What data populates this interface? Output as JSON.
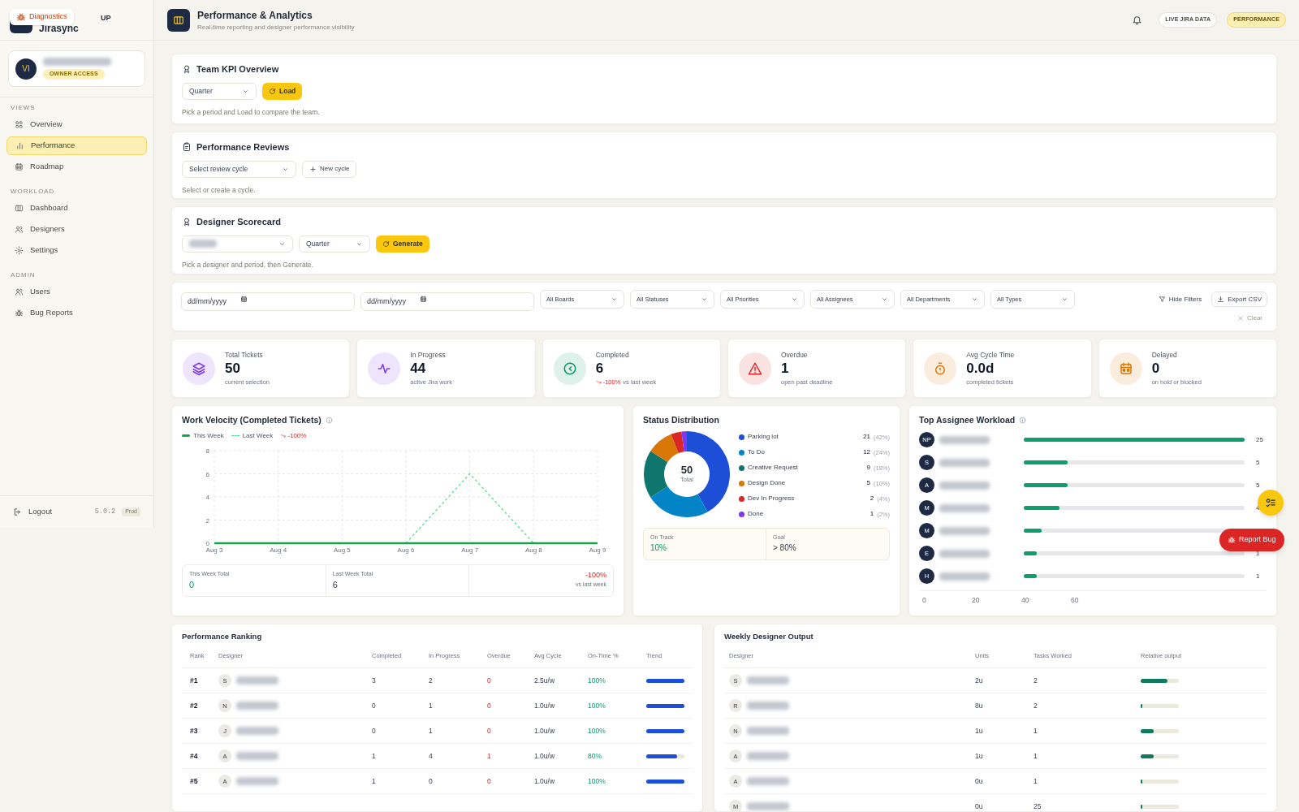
{
  "sidebar": {
    "brand": {
      "tag": "UP",
      "name": "Jirasync"
    },
    "diagnostics": "Diagnostics",
    "user": {
      "initials": "VI",
      "badge": "OWNER ACCESS"
    },
    "sections": [
      {
        "title": "VIEWS",
        "items": [
          {
            "label": "Overview",
            "selected": false
          },
          {
            "label": "Performance",
            "selected": true
          },
          {
            "label": "Roadmap",
            "selected": false
          }
        ]
      },
      {
        "title": "WORKLOAD",
        "items": [
          {
            "label": "Dashboard",
            "selected": false
          },
          {
            "label": "Designers",
            "selected": false
          },
          {
            "label": "Settings",
            "selected": false
          }
        ]
      },
      {
        "title": "ADMIN",
        "items": [
          {
            "label": "Users",
            "selected": false
          },
          {
            "label": "Bug Reports",
            "selected": false
          }
        ]
      }
    ],
    "logout": "Logout",
    "version": "5.0.2",
    "env": "Prod"
  },
  "header": {
    "title": "Performance & Analytics",
    "subtitle": "Real-time reporting and designer performance visibility",
    "badges": [
      {
        "label": "LIVE JIRA DATA",
        "kind": "outline"
      },
      {
        "label": "PERFORMANCE",
        "kind": "highlight"
      }
    ]
  },
  "panels": [
    {
      "title": "Team KPI Overview",
      "controls": [
        {
          "kind": "select",
          "value": "Quarter"
        },
        {
          "kind": "primary",
          "label": "Load"
        }
      ],
      "hint": "Pick a period and Load to compare the team."
    },
    {
      "title": "Performance Reviews",
      "controls": [
        {
          "kind": "select",
          "value": "Select review cycle"
        },
        {
          "kind": "secondary",
          "label": "New cycle"
        }
      ],
      "hint": "Select or create a cycle."
    },
    {
      "title": "Designer Scorecard",
      "controls": [
        {
          "kind": "blurred_select"
        },
        {
          "kind": "select",
          "value": "Quarter"
        },
        {
          "kind": "primary",
          "label": "Generate"
        }
      ],
      "hint": "Pick a designer and period, then Generate."
    }
  ],
  "filters": {
    "dates": [
      {
        "placeholder": "dd/mm/yyyy"
      },
      {
        "placeholder": "dd/mm/yyyy"
      }
    ],
    "selects": [
      "All Boards",
      "All Statuses",
      "All Priorities",
      "All Assignees",
      "All Departments",
      "All Types"
    ],
    "hide": "Hide Filters",
    "export": "Export CSV",
    "clear": "Clear"
  },
  "stats": [
    {
      "label": "Total Tickets",
      "value": "50",
      "note": "current selection",
      "color": "#7c3aed"
    },
    {
      "label": "In Progress",
      "value": "44",
      "note": "active Jira work",
      "color": "#7c3aed"
    },
    {
      "label": "Completed",
      "value": "6",
      "change": "-100%",
      "note": "vs last week",
      "color": "#059669"
    },
    {
      "label": "Overdue",
      "value": "1",
      "note": "open past deadline",
      "color": "#dc2626"
    },
    {
      "label": "Avg Cycle Time",
      "value": "0.0d",
      "note": "completed tickets",
      "color": "#d97706"
    },
    {
      "label": "Delayed",
      "value": "0",
      "note": "on hold or blocked",
      "color": "#d97706"
    }
  ],
  "velocity": {
    "title": "Work Velocity (Completed Tickets)",
    "legend_change": "-100%",
    "chart_data": {
      "type": "line",
      "grid": true,
      "categories": [
        "Aug 3",
        "Aug 4",
        "Aug 5",
        "Aug 6",
        "Aug 7",
        "Aug 8",
        "Aug 9"
      ],
      "ylim": [
        0,
        8
      ],
      "yticks": [
        {
          "value": 0,
          "label": "0"
        },
        {
          "value": 2,
          "label": "2"
        },
        {
          "value": 4,
          "label": "4"
        },
        {
          "value": 6,
          "label": "6"
        },
        {
          "value": 8,
          "label": "8"
        }
      ],
      "series": [
        {
          "name": "This Week",
          "color": "#16a34a",
          "line_style": "solid",
          "values": [
            0,
            0,
            0,
            0,
            0,
            0,
            0
          ]
        },
        {
          "name": "Last Week",
          "color": "#4ade80",
          "line_style": "dashed",
          "values": [
            null,
            null,
            null,
            0,
            6,
            0,
            null
          ]
        }
      ]
    },
    "totals": [
      {
        "label": "This Week Total",
        "value": "0"
      },
      {
        "label": "Last Week Total",
        "value": "6"
      }
    ],
    "change": {
      "value": "-100%",
      "note": "vs last week"
    }
  },
  "status": {
    "title": "Status Distribution",
    "center_value": "50",
    "center_label": "Total",
    "chart_data": {
      "type": "donut",
      "categories": [
        "Parking lot",
        "To Do",
        "Creative Request",
        "Design Done",
        "Dev In Progress",
        "Done"
      ],
      "values": [
        42,
        24,
        18,
        10,
        4,
        2
      ]
    },
    "items": [
      {
        "count": "21",
        "pct": "(42%)",
        "color": "#1d4ed8"
      },
      {
        "count": "12",
        "pct": "(24%)",
        "color": "#0284c7"
      },
      {
        "count": "9",
        "pct": "(18%)",
        "color": "#0f766e"
      },
      {
        "count": "5",
        "pct": "(10%)",
        "color": "#d97706"
      },
      {
        "count": "2",
        "pct": "(4%)",
        "color": "#dc2626"
      },
      {
        "count": "1",
        "pct": "(2%)",
        "color": "#7c3aed"
      }
    ],
    "footer": [
      {
        "label": "On Track",
        "value": "10%"
      },
      {
        "label": "Goal",
        "value": "> 80%"
      }
    ]
  },
  "workload": {
    "title": "Top Assignee Workload",
    "rows": [
      {
        "initials": "NP",
        "level": 1,
        "value": "25"
      },
      {
        "initials": "S",
        "level": 0.2,
        "value": "5"
      },
      {
        "initials": "A",
        "level": 0.2,
        "value": "5"
      },
      {
        "initials": "M",
        "level": 0.16,
        "value": "4"
      },
      {
        "initials": "M",
        "level": 0.08
      },
      {
        "initials": "E",
        "level": 0.06,
        "value": "1"
      },
      {
        "initials": "H",
        "level": 0.06,
        "value": "1"
      }
    ],
    "axis": [
      "0",
      "20",
      "40",
      "60"
    ]
  },
  "ranking": {
    "title": "Performance Ranking",
    "columns": [
      "Rank",
      "Designer",
      "Completed",
      "In Progress",
      "Overdue",
      "Avg Cycle",
      "On-Time %",
      "Trend"
    ],
    "rows": [
      {
        "rank": "#1",
        "initials": "S",
        "completed": "3",
        "in_progress": "2",
        "overdue": "0",
        "avg_cycle": "2.5u/w",
        "on_time": "100%",
        "level": 1
      },
      {
        "rank": "#2",
        "initials": "N",
        "completed": "0",
        "in_progress": "1",
        "overdue": "0",
        "avg_cycle": "1.0u/w",
        "on_time": "100%",
        "level": 1
      },
      {
        "rank": "#3",
        "initials": "J",
        "completed": "0",
        "in_progress": "1",
        "overdue": "0",
        "avg_cycle": "1.0u/w",
        "on_time": "100%",
        "level": 1
      },
      {
        "rank": "#4",
        "initials": "A",
        "completed": "1",
        "in_progress": "4",
        "overdue": "1",
        "avg_cycle": "1.0u/w",
        "on_time": "80%",
        "level": 0.8
      },
      {
        "rank": "#5",
        "initials": "A",
        "completed": "1",
        "in_progress": "0",
        "overdue": "0",
        "avg_cycle": "1.0u/w",
        "on_time": "100%",
        "level": 1
      }
    ]
  },
  "output": {
    "title": "Weekly Designer Output",
    "columns": [
      "Designer",
      "Units",
      "Tasks Worked",
      "Relative output"
    ],
    "rows": [
      {
        "initials": "S",
        "units": "2u",
        "tasks": "2",
        "level": 0.7
      },
      {
        "initials": "R",
        "units": "8u",
        "tasks": "2",
        "level": 0.05
      },
      {
        "initials": "N",
        "units": "1u",
        "tasks": "1",
        "level": 0.33
      },
      {
        "initials": "A",
        "units": "1u",
        "tasks": "1",
        "level": 0.33
      },
      {
        "initials": "A",
        "units": "0u",
        "tasks": "1",
        "level": 0.05
      },
      {
        "initials": "M",
        "units": "0u",
        "tasks": "25",
        "level": 0.05
      }
    ]
  },
  "report_bug": "Report Bug"
}
